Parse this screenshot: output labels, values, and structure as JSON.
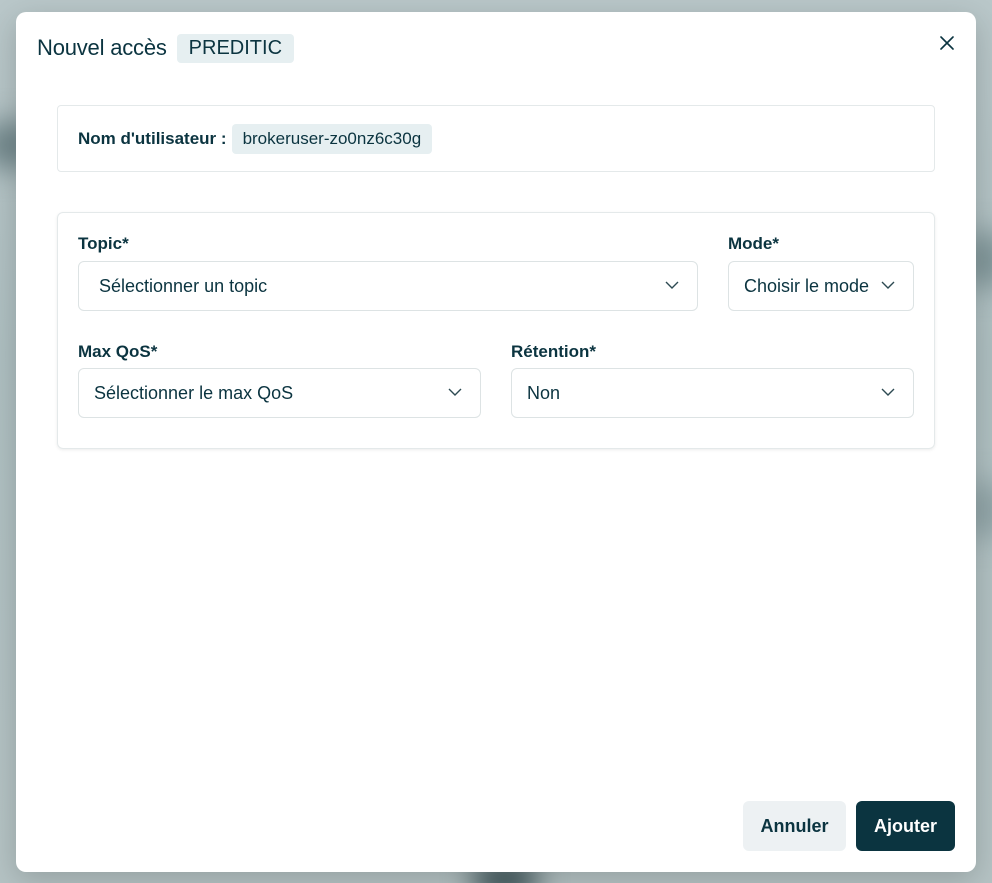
{
  "modal": {
    "title": "Nouvel accès",
    "badge": "PREDITIC"
  },
  "user": {
    "label": "Nom d'utilisateur :",
    "value": "brokeruser-zo0nz6c30g"
  },
  "form": {
    "topic": {
      "label": "Topic*",
      "placeholder": "Sélectionner un topic"
    },
    "mode": {
      "label": "Mode*",
      "placeholder": "Choisir le mode"
    },
    "max_qos": {
      "label": "Max QoS*",
      "placeholder": "Sélectionner le max QoS"
    },
    "retention": {
      "label": "Rétention*",
      "value": "Non"
    }
  },
  "actions": {
    "cancel_label": "Annuler",
    "add_label": "Ajouter"
  },
  "icons": {
    "close": "close-icon",
    "chevron": "chevron-down-icon"
  },
  "colors": {
    "primary": "#0b3440",
    "badge_bg": "#e6eff1",
    "cancel_bg": "#edf1f3"
  }
}
